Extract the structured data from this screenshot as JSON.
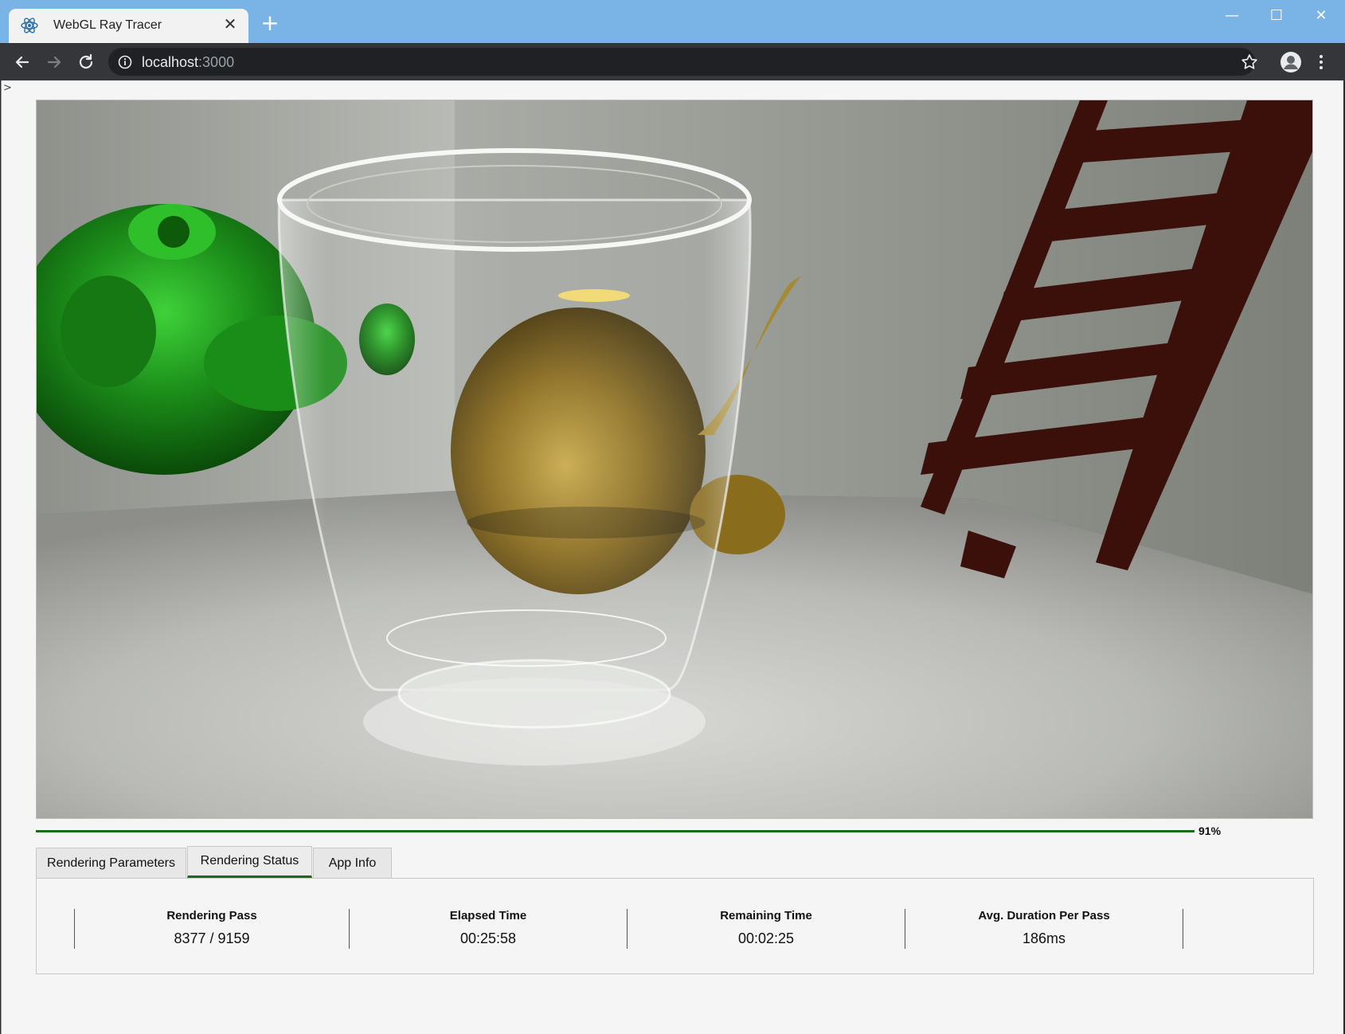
{
  "browser": {
    "tab_title": "WebGL Ray Tracer",
    "favicon": "react-atom-icon",
    "new_tab_icon": "plus-icon",
    "close_tab_icon": "close-icon",
    "url_host": "localhost",
    "url_port": ":3000",
    "colors": {
      "titlebar": "#7ab4e6",
      "toolbar": "#35363a",
      "omnibox": "#202124"
    }
  },
  "render": {
    "progress_percent": 91,
    "progress_label": "91%",
    "accent_color": "#1a6b1a"
  },
  "tabs": [
    {
      "label": "Rendering Parameters",
      "active": false
    },
    {
      "label": "Rendering Status",
      "active": true
    },
    {
      "label": "App Info",
      "active": false
    }
  ],
  "status": {
    "rendering_pass_label": "Rendering Pass",
    "rendering_pass_value": "8377 / 9159",
    "elapsed_label": "Elapsed Time",
    "elapsed_value": "00:25:58",
    "remaining_label": "Remaining Time",
    "remaining_value": "00:02:25",
    "avg_label": "Avg. Duration Per Pass",
    "avg_value": "186ms"
  }
}
